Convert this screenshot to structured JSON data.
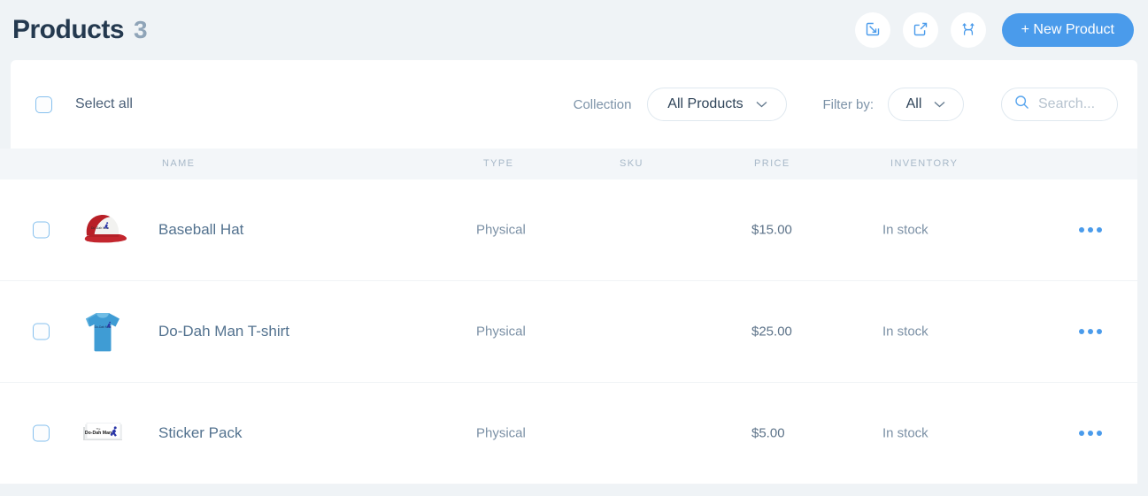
{
  "header": {
    "title": "Products",
    "count": "3",
    "actions": [
      {
        "name": "import-button",
        "icon": "import-icon"
      },
      {
        "name": "export-button",
        "icon": "export-icon"
      },
      {
        "name": "merge-split-button",
        "icon": "merge-split-icon"
      }
    ],
    "new_product_label": "+ New Product"
  },
  "toolbar": {
    "select_all_label": "Select all",
    "collection_label": "Collection",
    "collection_value": "All Products",
    "filter_by_label": "Filter by:",
    "filter_by_value": "All",
    "search_placeholder": "Search...",
    "search_value": ""
  },
  "table": {
    "columns": [
      "NAME",
      "TYPE",
      "SKU",
      "PRICE",
      "INVENTORY"
    ],
    "rows": [
      {
        "name": "Baseball Hat",
        "type": "Physical",
        "sku": "",
        "price": "$15.00",
        "inventory": "In stock",
        "thumb": "baseball-hat-thumbnail"
      },
      {
        "name": "Do-Dah Man T-shirt",
        "type": "Physical",
        "sku": "",
        "price": "$25.00",
        "inventory": "In stock",
        "thumb": "tshirt-thumbnail"
      },
      {
        "name": "Sticker Pack",
        "type": "Physical",
        "sku": "",
        "price": "$5.00",
        "inventory": "In stock",
        "thumb": "sticker-pack-thumbnail"
      }
    ]
  },
  "colors": {
    "accent": "#4a9beb",
    "page_bg": "#eff3f6",
    "title": "#24394f",
    "muted": "#7b90a5"
  }
}
